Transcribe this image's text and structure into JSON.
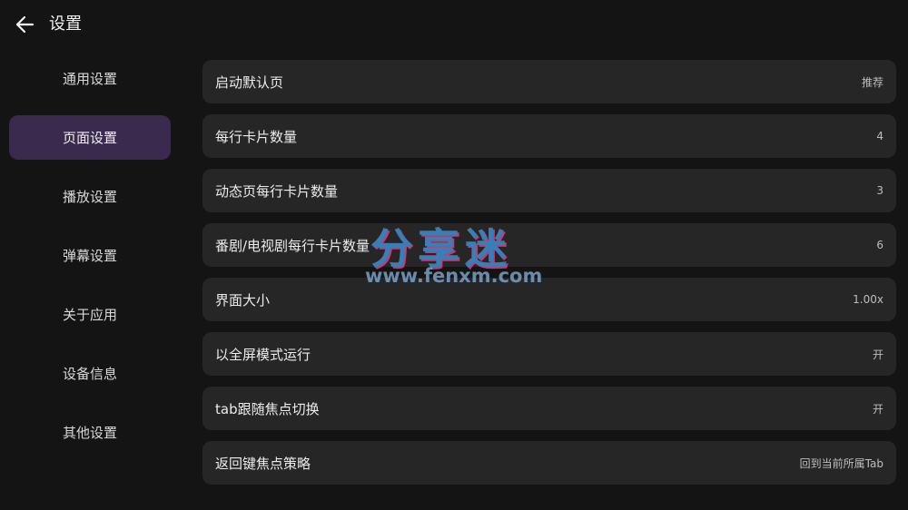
{
  "header": {
    "title": "设置",
    "back_icon": "arrow-left-icon"
  },
  "sidebar": {
    "items": [
      {
        "label": "通用设置",
        "active": false
      },
      {
        "label": "页面设置",
        "active": true
      },
      {
        "label": "播放设置",
        "active": false
      },
      {
        "label": "弹幕设置",
        "active": false
      },
      {
        "label": "关于应用",
        "active": false
      },
      {
        "label": "设备信息",
        "active": false
      },
      {
        "label": "其他设置",
        "active": false
      }
    ]
  },
  "settings": {
    "rows": [
      {
        "label": "启动默认页",
        "value": "推荐"
      },
      {
        "label": "每行卡片数量",
        "value": "4"
      },
      {
        "label": "动态页每行卡片数量",
        "value": "3"
      },
      {
        "label": "番剧/电视剧每行卡片数量",
        "value": "6"
      },
      {
        "label": "界面大小",
        "value": "1.00x"
      },
      {
        "label": "以全屏模式运行",
        "value": "开"
      },
      {
        "label": "tab跟随焦点切换",
        "value": "开"
      },
      {
        "label": "返回键焦点策略",
        "value": "回到当前所属Tab"
      }
    ]
  },
  "watermark": {
    "text": "分享迷",
    "url": "www.fenxm.com"
  },
  "colors": {
    "background": "#141414",
    "row_background": "#262626",
    "active_sidebar": "#3a2a4e"
  }
}
